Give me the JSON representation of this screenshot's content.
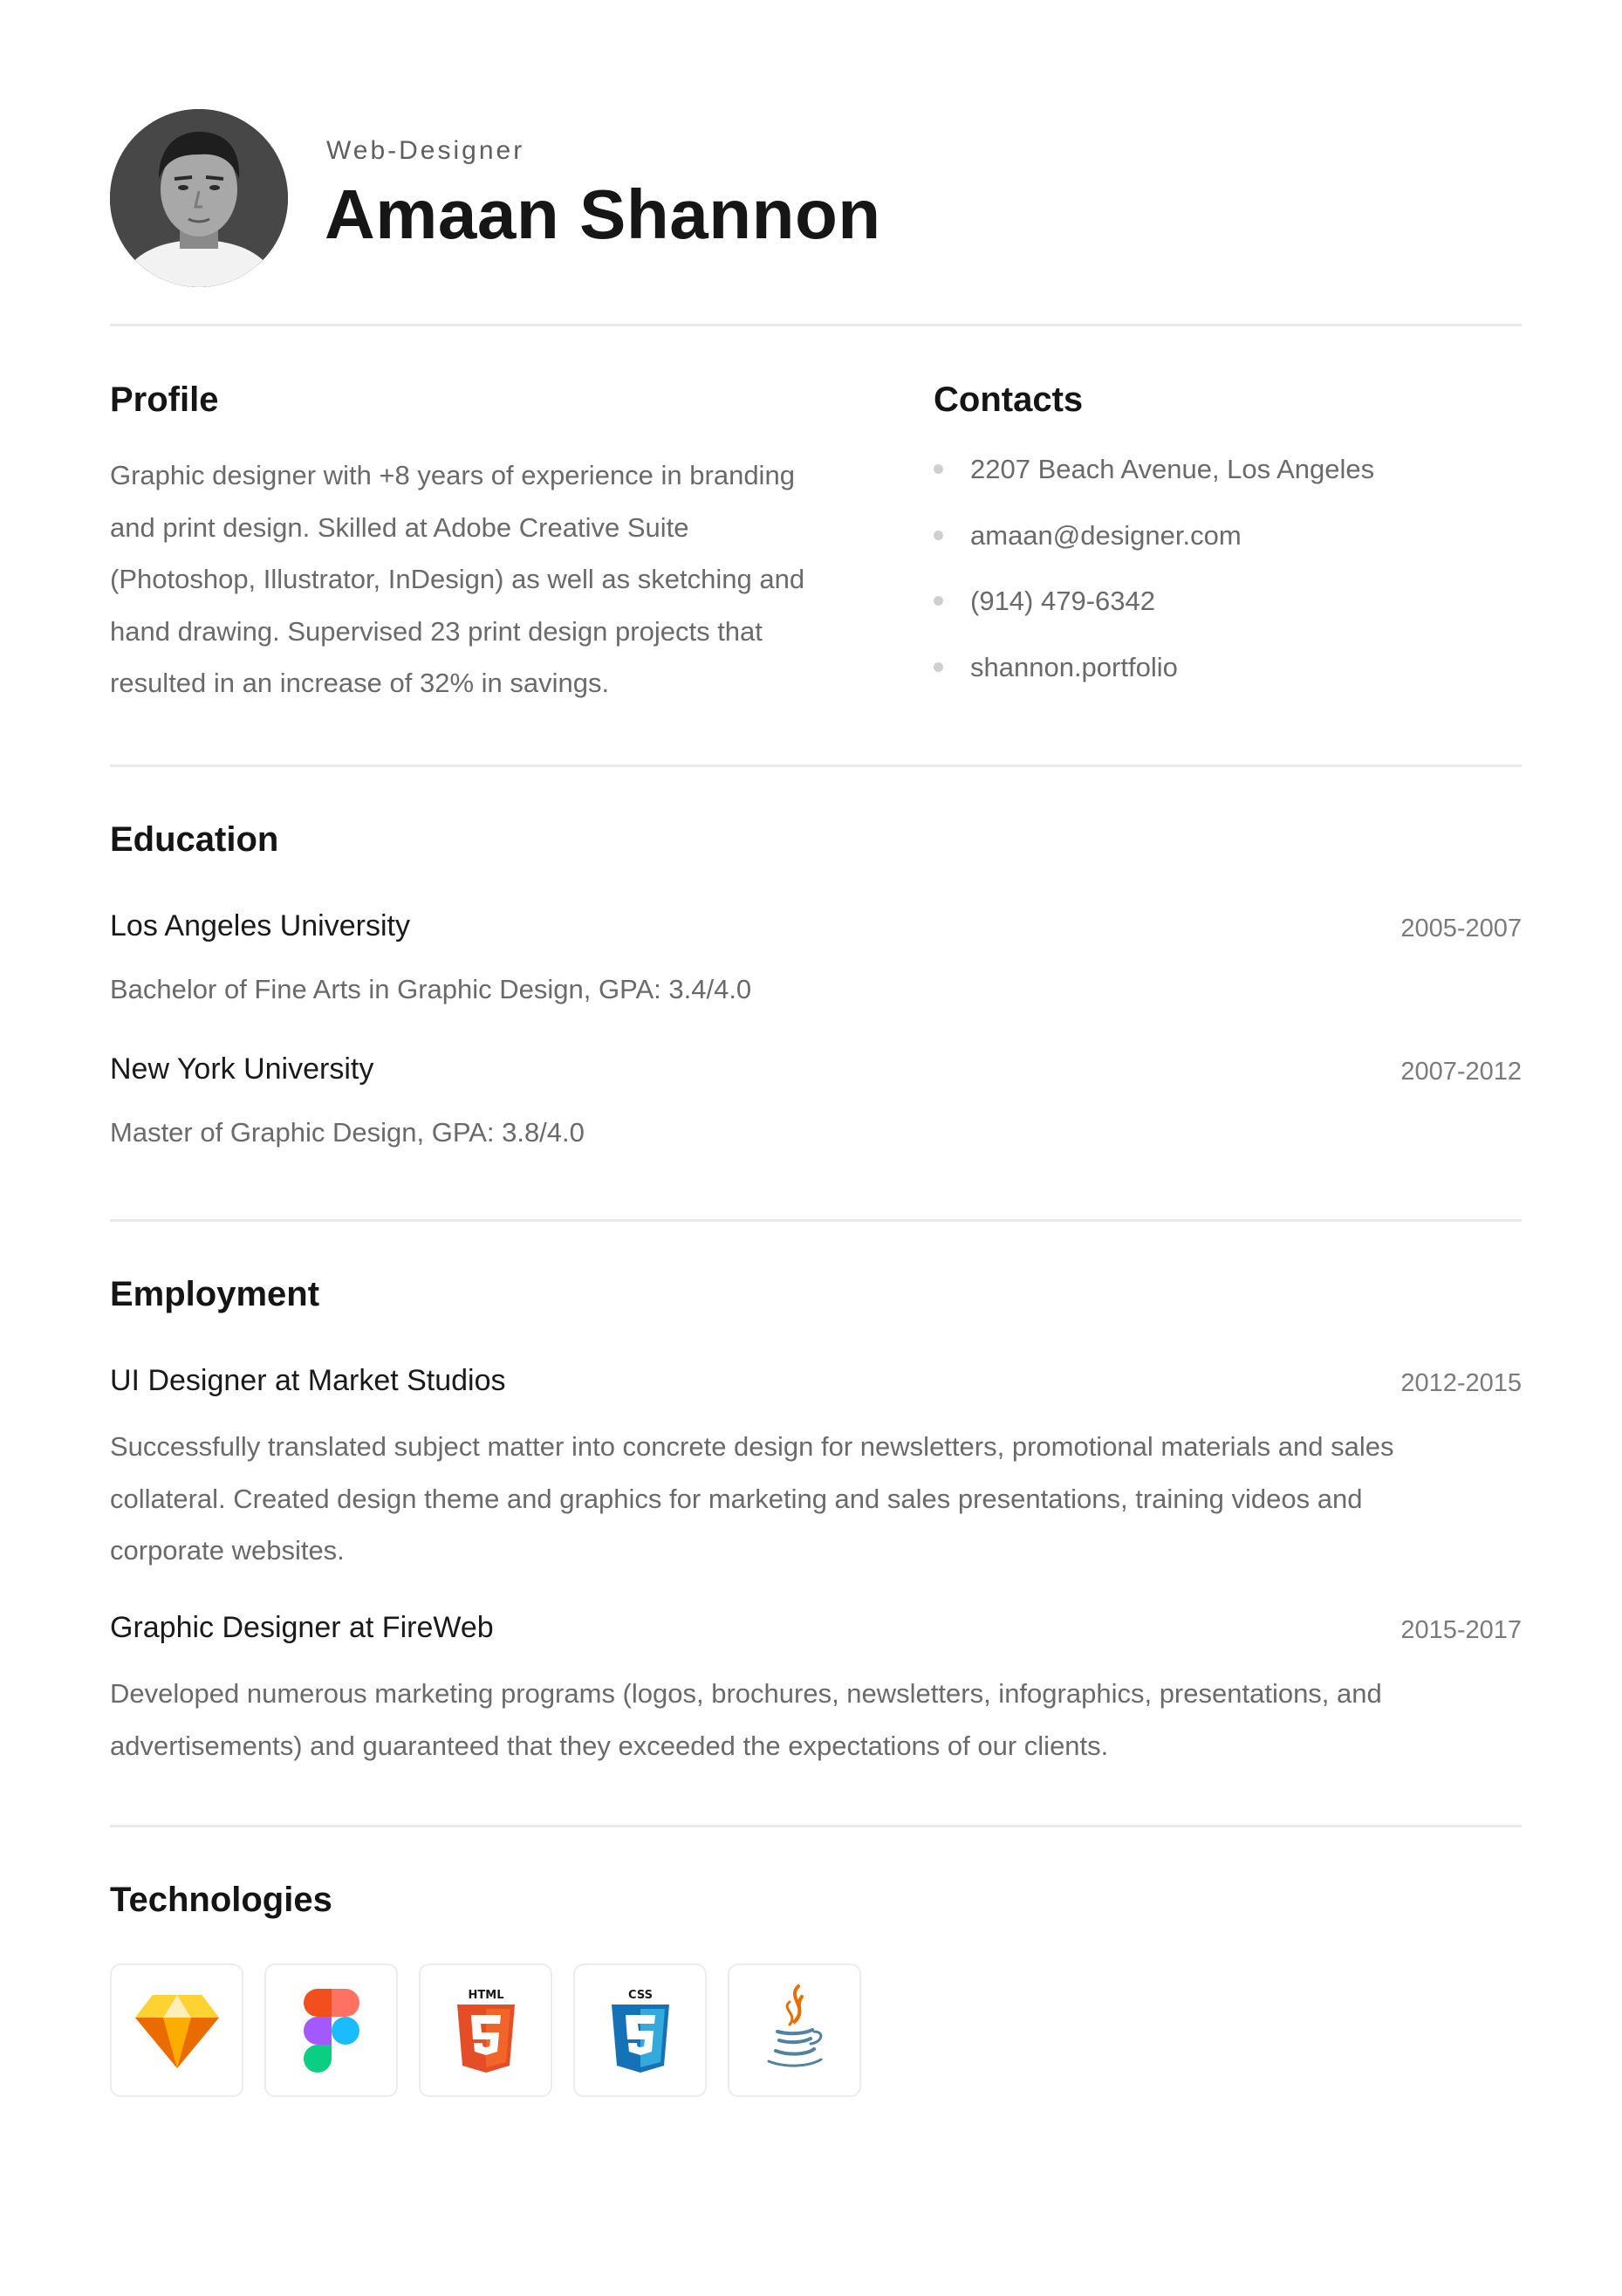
{
  "header": {
    "subtitle": "Web-Designer",
    "name": "Amaan Shannon"
  },
  "profile": {
    "heading": "Profile",
    "lines": [
      "Graphic designer with +8 years of experience in branding",
      "and print design. Skilled at Adobe Creative Suite",
      "(Photoshop, Illustrator, InDesign) as well as sketching and",
      "hand drawing. Supervised 23 print design projects that",
      "resulted in an increase of 32% in savings."
    ]
  },
  "contacts": {
    "heading": "Contacts",
    "items": [
      "2207 Beach Avenue, Los Angeles",
      "amaan@designer.com",
      "(914) 479-6342",
      "shannon.portfolio"
    ]
  },
  "education": {
    "heading": "Education",
    "entries": [
      {
        "title": "Los Angeles University",
        "date": "2005-2007",
        "detail": "Bachelor of Fine Arts in Graphic Design, GPA: 3.4/4.0"
      },
      {
        "title": "New York University",
        "date": "2007-2012",
        "detail": "Master of Graphic Design, GPA: 3.8/4.0"
      }
    ]
  },
  "employment": {
    "heading": "Employment",
    "entries": [
      {
        "title": "UI Designer at Market Studios",
        "date": "2012-2015",
        "lines": [
          "Successfully translated subject matter into concrete design for newsletters, promotional materials and sales",
          "collateral. Created design theme and graphics for marketing and sales presentations, training videos and",
          "corporate websites."
        ]
      },
      {
        "title": "Graphic Designer at FireWeb",
        "date": "2015-2017",
        "lines": [
          "Developed numerous marketing programs (logos, brochures, newsletters, infographics, presentations, and",
          "advertisements) and guaranteed that they exceeded the expectations of our clients."
        ]
      }
    ]
  },
  "technologies": {
    "heading": "Technologies",
    "icons": [
      "sketch-icon",
      "figma-icon",
      "html5-icon",
      "css3-icon",
      "java-icon"
    ],
    "html_label": "HTML",
    "css_label": "CSS"
  }
}
